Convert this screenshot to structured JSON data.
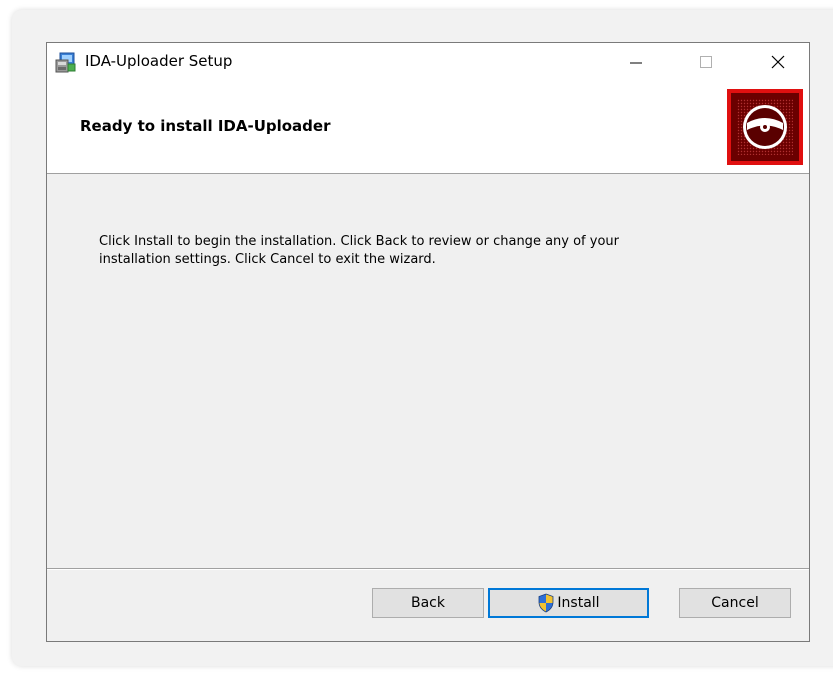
{
  "window": {
    "title": "IDA-Uploader Setup",
    "icon": "installer-icon",
    "controls": {
      "minimize_glyph": "—",
      "maximize_glyph": "☐",
      "close_glyph": "✕"
    }
  },
  "header": {
    "title": "Ready to install IDA-Uploader",
    "logo_icon": "disc-icon",
    "logo_colors": {
      "border": "#e01010",
      "fill": "#6b0000"
    }
  },
  "body": {
    "line1": "Click Install to begin the installation. Click Back to review or change any of your",
    "line2": "installation settings. Click Cancel to exit the wizard."
  },
  "footer": {
    "back_label": "Back",
    "install_label": "Install",
    "install_icon": "uac-shield-icon",
    "cancel_label": "Cancel",
    "accent_color": "#0078d7"
  }
}
